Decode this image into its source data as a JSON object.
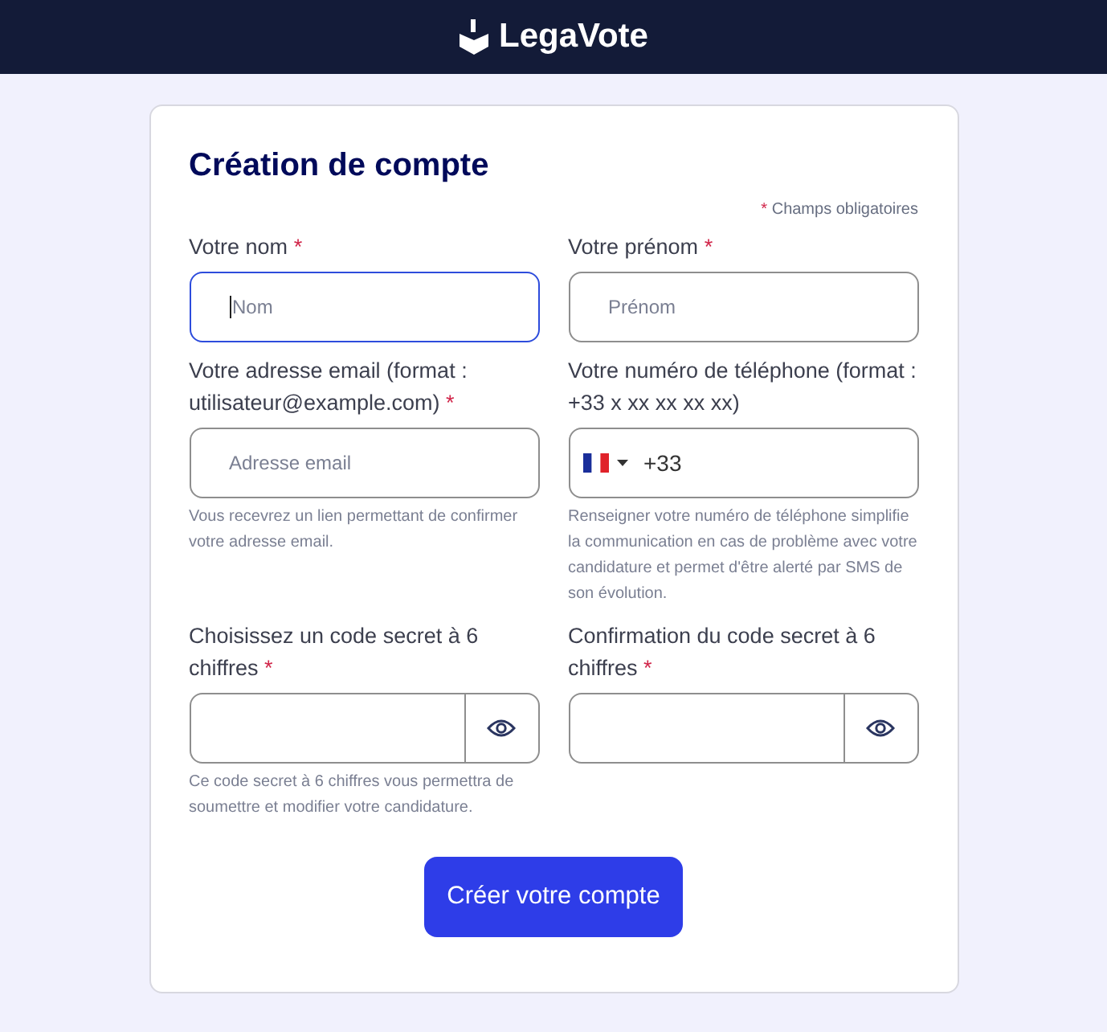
{
  "header": {
    "brand": "LegaVote"
  },
  "form": {
    "title": "Création de compte",
    "required_mark": "*",
    "required_note": "Champs obligatoires",
    "fields": [
      {
        "kind": "text",
        "label": "Votre nom",
        "required": true,
        "placeholder": "Nom",
        "focused": true
      },
      {
        "kind": "text",
        "label": "Votre prénom",
        "required": true,
        "placeholder": "Prénom",
        "focused": false
      },
      {
        "kind": "text",
        "label": "Votre adresse email (format : utilisateur@example.com)",
        "required": true,
        "placeholder": "Adresse email",
        "focused": false,
        "help": "Vous recevrez un lien permettant de confirmer votre adresse email."
      },
      {
        "kind": "phone",
        "label": "Votre numéro de téléphone (format : +33 x xx xx xx xx)",
        "required": false,
        "value": "+33",
        "focused": false,
        "help": "Renseigner votre numéro de téléphone simplifie la communication en cas de problème avec votre candidature et permet d'être alerté par SMS de son évolution."
      },
      {
        "kind": "secret",
        "label": "Choisissez un code secret à 6 chiffres",
        "required": true,
        "focused": false,
        "help": "Ce code secret à 6 chiffres vous permettra de soumettre et modifier votre candidature."
      },
      {
        "kind": "secret",
        "label": "Confirmation du code secret à 6 chiffres",
        "required": true,
        "focused": false
      }
    ],
    "submit": "Créer votre compte"
  }
}
